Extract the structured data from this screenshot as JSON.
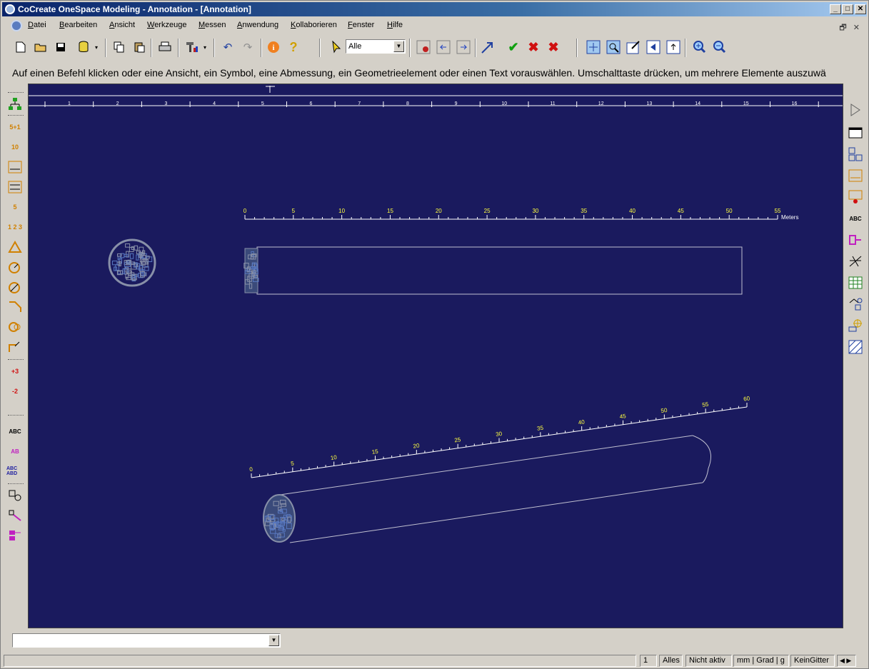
{
  "window": {
    "title": "CoCreate OneSpace Modeling - Annotation - [Annotation]",
    "minimize": "_",
    "maximize": "□",
    "close": "✕"
  },
  "menu": {
    "items": [
      "Datei",
      "Bearbeiten",
      "Ansicht",
      "Werkzeuge",
      "Messen",
      "Anwendung",
      "Kollaborieren",
      "Fenster",
      "Hilfe"
    ],
    "mdi_restore": "🗗",
    "mdi_close": "✕"
  },
  "toolbar": {
    "filter_value": "Alle"
  },
  "prompt": "Auf einen Befehl klicken oder eine Ansicht, ein Symbol, eine Abmessung, ein Geometrieelement oder einen Text vorauswählen. Umschalttaste drücken, um mehrere Elemente auszuwä",
  "left_palette": {
    "labels": [
      "5+1",
      "10",
      "5",
      "1 2 3",
      "+3",
      "-2",
      "ABC",
      "AB",
      "ABC ABD"
    ]
  },
  "right_palette": {
    "labels": [
      "ABC"
    ]
  },
  "drawing": {
    "top_ruler_labels": [
      "1",
      "2",
      "3",
      "4",
      "5",
      "6",
      "7",
      "8",
      "9",
      "10",
      "11",
      "12",
      "13",
      "14",
      "15",
      "16"
    ],
    "front_ruler_labels": [
      "0",
      "5",
      "10",
      "15",
      "20",
      "25",
      "30",
      "35",
      "40",
      "45",
      "50",
      "55"
    ],
    "front_ruler_unit": "Meters",
    "iso_ruler_labels": [
      "0",
      "5",
      "10",
      "15",
      "20",
      "25",
      "30",
      "35",
      "40",
      "45",
      "50",
      "55",
      "60"
    ],
    "background_color": "#1a1a5e",
    "ruler_color": "#ffffff",
    "label_color": "#ffff40",
    "outline_color": "#c0c0d0"
  },
  "status": {
    "page": "1",
    "mode": "Alles",
    "state": "Nicht aktiv",
    "units": "mm | Grad | g",
    "grid": "KeinGitter"
  }
}
